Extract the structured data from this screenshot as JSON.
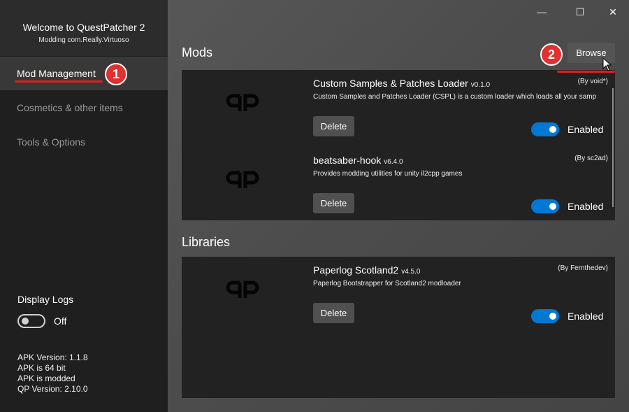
{
  "app": {
    "title": "Welcome to QuestPatcher 2",
    "subtitle": "Modding com.Really.Virtuoso"
  },
  "sidebar": {
    "items": [
      {
        "label": "Mod Management",
        "active": true
      },
      {
        "label": "Cosmetics & other items",
        "active": false
      },
      {
        "label": "Tools & Options",
        "active": false
      }
    ],
    "display_logs": {
      "label": "Display Logs",
      "state": "Off"
    },
    "versions": [
      "APK Version: 1.1.8",
      "APK is 64 bit",
      "APK is modded",
      "QP Version: 2.10.0"
    ]
  },
  "window_controls": {
    "minimize": "—",
    "maximize": "☐",
    "close": "✕"
  },
  "mods_section": {
    "title": "Mods",
    "browse_label": "Browse",
    "mods": [
      {
        "name": "Custom Samples & Patches Loader",
        "version": "v0.1.0",
        "author": "(By void*)",
        "description": "Custom Samples and Patches Loader (CSPL) is a custom loader which loads all your samp",
        "delete_label": "Delete",
        "enabled_label": "Enabled",
        "enabled": true
      },
      {
        "name": "beatsaber-hook",
        "version": "v6.4.0",
        "author": "(By sc2ad)",
        "description": "Provides modding utilities for unity il2cpp games",
        "delete_label": "Delete",
        "enabled_label": "Enabled",
        "enabled": true
      }
    ]
  },
  "libraries_section": {
    "title": "Libraries",
    "mods": [
      {
        "name": "Paperlog Scotland2",
        "version": "v4.5.0",
        "author": "(By Fernthedev)",
        "description": "Paperlog Bootstrapper for Scotland2 modloader",
        "delete_label": "Delete",
        "enabled_label": "Enabled",
        "enabled": true
      }
    ]
  },
  "annotations": {
    "badge_1": "1",
    "badge_2": "2"
  },
  "colors": {
    "accent": "#0078d4",
    "annotation": "#e03030",
    "sidebar": "#1f1f1f",
    "card": "#222222"
  }
}
